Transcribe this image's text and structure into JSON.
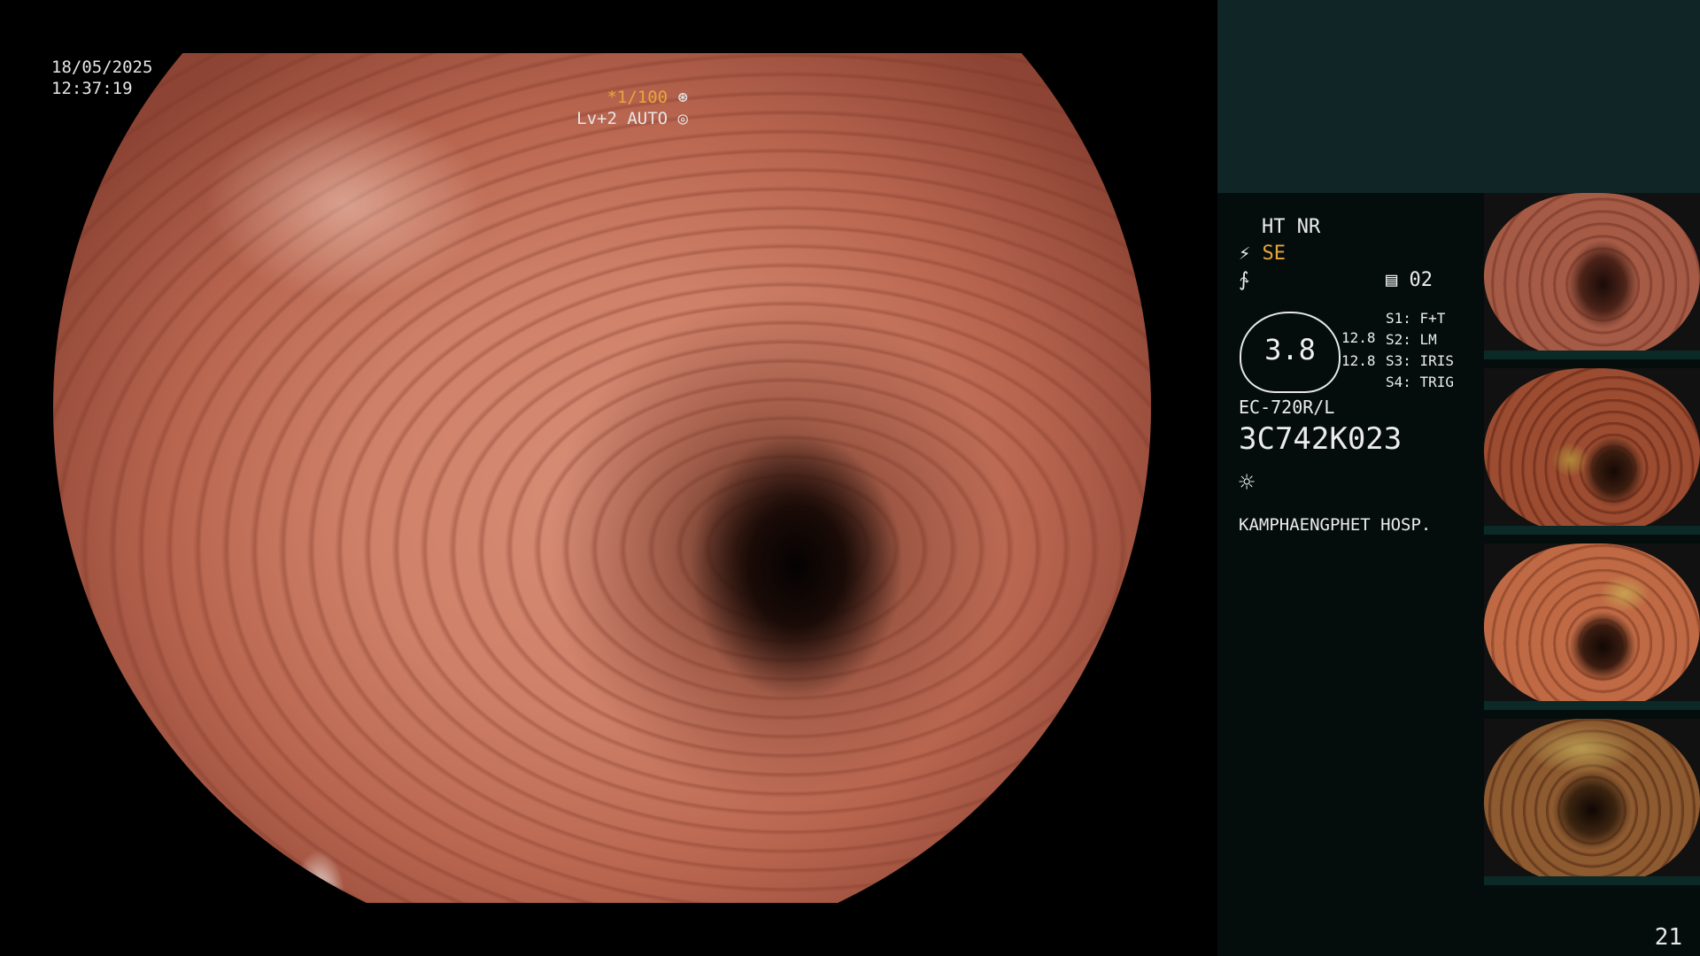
{
  "overlay": {
    "date": "18/05/2025",
    "time": "12:37:19",
    "shutter": "*1/100",
    "level": "Lv+2 AUTO"
  },
  "side_panel": {
    "mode": "HT NR",
    "se_label": "SE",
    "channel": "02",
    "gauge_value": "3.8",
    "values": [
      "12.8",
      "12.8"
    ],
    "switches": [
      {
        "key": "S1",
        "value": "F+T"
      },
      {
        "key": "S2",
        "value": "LM"
      },
      {
        "key": "S3",
        "value": "IRIS"
      },
      {
        "key": "S4",
        "value": "TRIG"
      }
    ],
    "scope_model": "EC-720R/L",
    "serial": "3C742K023",
    "hospital": "KAMPHAENGPHET HOSP.",
    "colors": {
      "se": "#e8a63c",
      "panel": "#040d0c",
      "panel_top": "#0f2526"
    }
  },
  "page_number": "21"
}
